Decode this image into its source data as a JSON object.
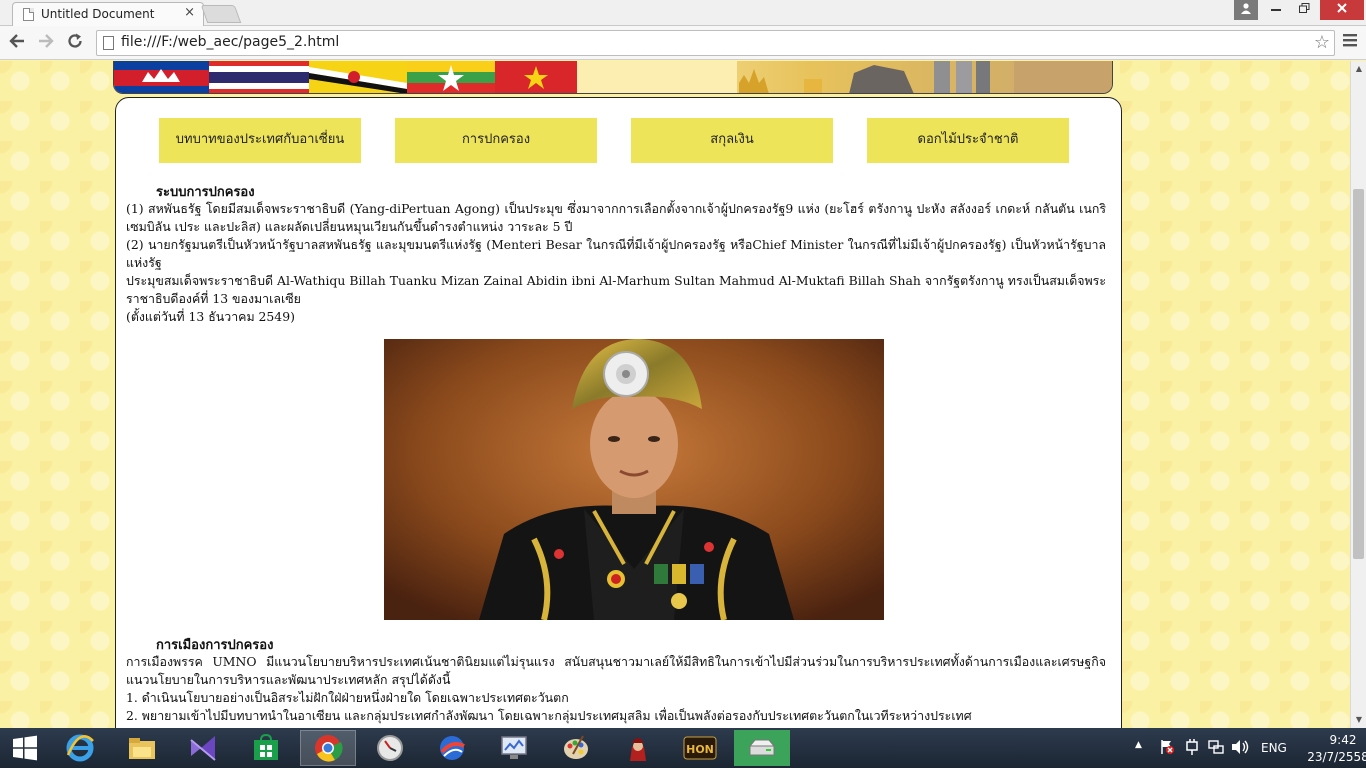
{
  "browser": {
    "tab_title": "Untitled Document",
    "tab_close": "×",
    "url": "file:///F:/web_aec/page5_2.html",
    "back_icon": "back-arrow-icon",
    "forward_icon": "forward-arrow-icon",
    "reload_icon": "reload-icon",
    "star_icon": "bookmark-star-icon",
    "menu_icon": "hamburger-menu-icon"
  },
  "menu": [
    {
      "label": "บทบาทของประเทศกับอาเซี่ยน"
    },
    {
      "label": "การปกครอง"
    },
    {
      "label": "สกุลเงิน"
    },
    {
      "label": "ดอกไม้ประจำชาติ"
    }
  ],
  "section1": {
    "heading": "ระบบการปกครอง",
    "p1": "(1) สหพันธรัฐ โดยมีสมเด็จพระราชาธิบดี (Yang-diPertuan Agong) เป็นประมุข ซึ่งมาจากการเลือกตั้งจากเจ้าผู้ปกครองรัฐ9 แห่ง (ยะโฮร์ ตรังกานู ปะหัง สลังงอร์ เกดะห์ กลันตัน เนกริเซมบิลัน เประ และปะลิส) และผลัดเปลี่ยนหมุนเวียนกันขึ้นดำรงตำแหน่ง วาระละ 5 ปี",
    "p2": "(2) นายกรัฐมนตรีเป็นหัวหน้ารัฐบาลสหพันธรัฐ และมุขมนตรีแห่งรัฐ (Menteri Besar ในกรณีที่มีเจ้าผู้ปกครองรัฐ หรือChief Minister ในกรณีที่ไม่มีเจ้าผู้ปกครองรัฐ) เป็นหัวหน้ารัฐบาลแห่งรัฐ",
    "p3": "ประมุขสมเด็จพระราชาธิบดี Al-Wathiqu Billah Tuanku Mizan Zainal Abidin ibni Al-Marhum Sultan Mahmud Al-Muktafi Billah Shah จากรัฐตรังกานู ทรงเป็นสมเด็จพระราชาธิบดีองค์ที่ 13 ของมาเลเซีย",
    "p4": "(ตั้งแต่วันที่ 13 ธันวาคม 2549)"
  },
  "section2": {
    "heading": "การเมืองการปกครอง",
    "p1": "การเมืองพรรค UMNO มีแนวนโยบายบริหารประเทศเน้นชาติ​นิยมแต่ไม่รุนแรง สนับสนุนชาวมาเลย์ให้มีสิทธิในการเข้าไปมีส่วนร่วมในการบริหารประเทศทั้งด้านการเมืองและเศรษฐกิจ แนวนโยบายในการบริหารและพัฒนาประเทศหลัก สรุปได้ดังนี้",
    "item1": "1. ดำเนินนโยบายอย่างเป็นอิสระไม่ฝักใฝ่ฝ่ายหนึ่งฝ่ายใด โดยเฉพาะประเทศตะวันตก",
    "item2": "2. พยายามเข้าไปมีบทบาทนำในอาเซียน และกลุ่มประเทศกำลังพัฒนา โดยเฉพาะกลุ่มประเทศมุสลิม เพื่อเป็นพลังต่อรองกับประเทศตะวันตกในเวทีระหว่างประเทศ"
  },
  "taskbar": {
    "lang": "ENG",
    "time": "9:42",
    "date": "23/7/2558"
  },
  "colors": {
    "page_bg": "#fbf1a5",
    "menu_tile": "#ede45a",
    "close_btn": "#c7393a",
    "taskbar": "#233041"
  }
}
